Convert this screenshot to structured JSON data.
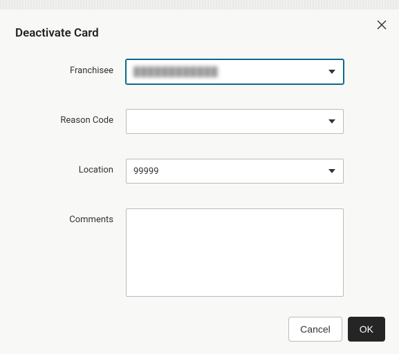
{
  "dialog": {
    "title": "Deactivate Card"
  },
  "fields": {
    "franchisee": {
      "label": "Franchisee",
      "value": "████████████"
    },
    "reason_code": {
      "label": "Reason Code",
      "value": ""
    },
    "location": {
      "label": "Location",
      "value": "99999"
    },
    "comments": {
      "label": "Comments",
      "value": ""
    }
  },
  "buttons": {
    "cancel": "Cancel",
    "ok": "OK"
  }
}
